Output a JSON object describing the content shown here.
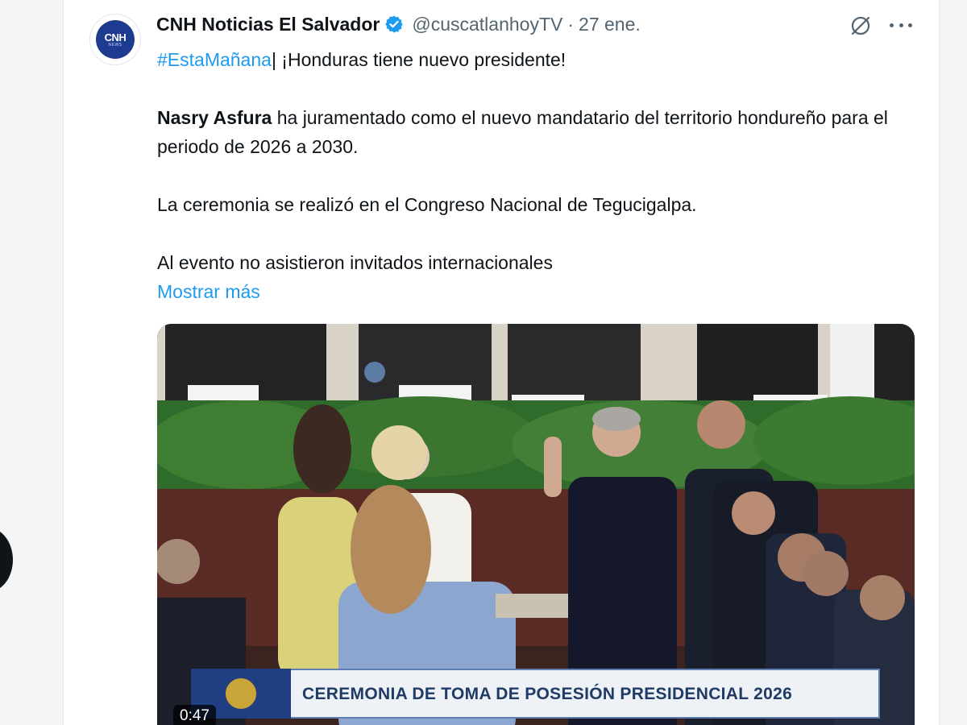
{
  "tweet": {
    "author_name": "CNH Noticias El Salvador",
    "handle": "@cuscatlanhoyTV",
    "separator": "·",
    "date": "27 ene.",
    "avatar_text": "CNH",
    "avatar_subtext": "NEWS",
    "icons": {
      "verified": "verified-badge-icon",
      "grok": "grok-icon",
      "more": "more-options-icon"
    },
    "line1": {
      "hashtag": "#EstaMañana",
      "text": "| ¡Honduras tiene nuevo presidente!"
    },
    "paragraph2": {
      "bold": "Nasry Asfura",
      "text": " ha juramentado como el nuevo mandatario del territorio hondureño para el periodo de 2026 a 2030."
    },
    "paragraph3": "La ceremonia se realizó en el Congreso Nacional de Tegucigalpa.",
    "paragraph4": "Al evento no asistieron invitados internacionales",
    "show_more": "Mostrar más"
  },
  "media": {
    "lower_third_title": "CEREMONIA DE TOMA DE POSESIÓN PRESIDENCIAL 2026",
    "duration": "0:47"
  },
  "colors": {
    "accent": "#1d9bf0",
    "verified_badge": "#1d9bf0",
    "text_primary": "#0f1419",
    "text_secondary": "#536471"
  }
}
